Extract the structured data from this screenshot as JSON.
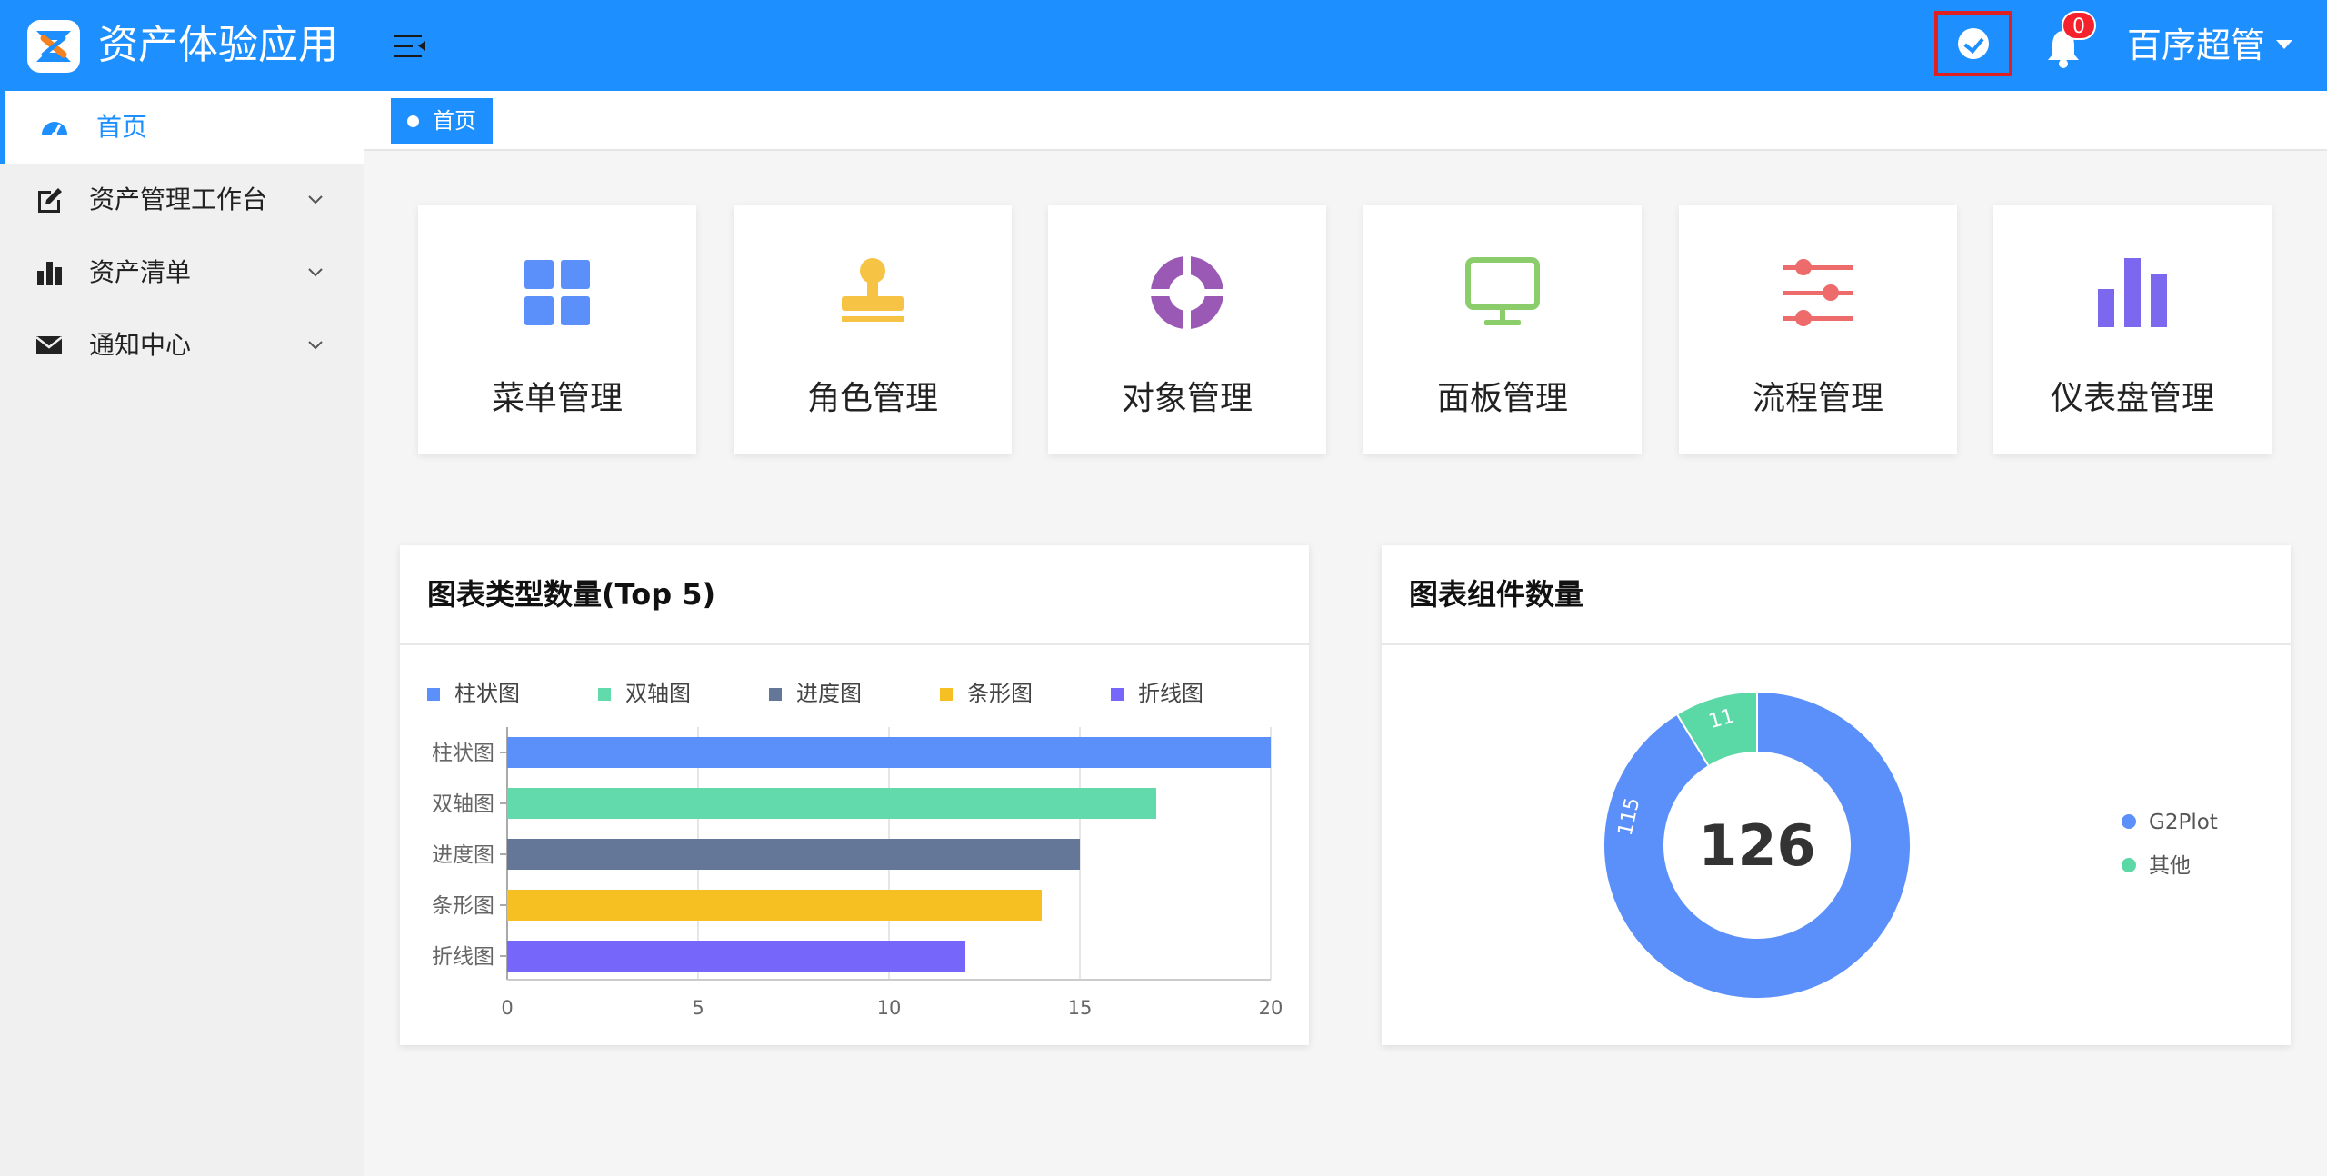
{
  "header": {
    "app_title": "资产体验应用",
    "notification_count": "0",
    "user_name": "百序超管",
    "brand_color": "#1e8fff"
  },
  "sidebar": {
    "items": [
      {
        "label": "首页",
        "icon": "dashboard-icon",
        "active": true
      },
      {
        "label": "资产管理工作台",
        "icon": "edit-icon",
        "expandable": true
      },
      {
        "label": "资产清单",
        "icon": "bar-chart-icon",
        "expandable": true
      },
      {
        "label": "通知中心",
        "icon": "mail-icon",
        "expandable": true
      }
    ]
  },
  "tabs": [
    {
      "label": "首页",
      "active": true
    }
  ],
  "cards": [
    {
      "label": "菜单管理",
      "icon": "grid-icon",
      "color": "#5b8ff9"
    },
    {
      "label": "角色管理",
      "icon": "stamp-icon",
      "color": "#f6c344"
    },
    {
      "label": "对象管理",
      "icon": "lifebuoy-icon",
      "color": "#9b59b6"
    },
    {
      "label": "面板管理",
      "icon": "monitor-icon",
      "color": "#8ccd6b"
    },
    {
      "label": "流程管理",
      "icon": "sliders-icon",
      "color": "#ed6b6b"
    },
    {
      "label": "仪表盘管理",
      "icon": "bar-chart-icon",
      "color": "#7b68ee"
    }
  ],
  "bar_panel": {
    "title": "图表类型数量(Top 5)"
  },
  "donut_panel": {
    "title": "图表组件数量",
    "center_value": "126"
  },
  "chart_data": [
    {
      "type": "bar",
      "orientation": "horizontal",
      "title": "图表类型数量(Top 5)",
      "categories": [
        "柱状图",
        "双轴图",
        "进度图",
        "条形图",
        "折线图"
      ],
      "values": [
        20,
        17,
        15,
        14,
        12
      ],
      "colors": [
        "#5b8ff9",
        "#62daab",
        "#657798",
        "#f6c022",
        "#7666f9"
      ],
      "legend": [
        "柱状图",
        "双轴图",
        "进度图",
        "条形图",
        "折线图"
      ],
      "legend_position": "top",
      "xlim": [
        0,
        20
      ],
      "xticks": [
        "0",
        "5",
        "10",
        "15",
        "20"
      ],
      "grid": true
    },
    {
      "type": "pie",
      "variant": "donut",
      "title": "图表组件数量",
      "labels": [
        "G2Plot",
        "其他"
      ],
      "values": [
        115,
        11
      ],
      "colors": [
        "#5b8ff9",
        "#5ad8a6"
      ],
      "total": "126",
      "legend": [
        "G2Plot",
        "其他"
      ],
      "legend_position": "right"
    }
  ]
}
